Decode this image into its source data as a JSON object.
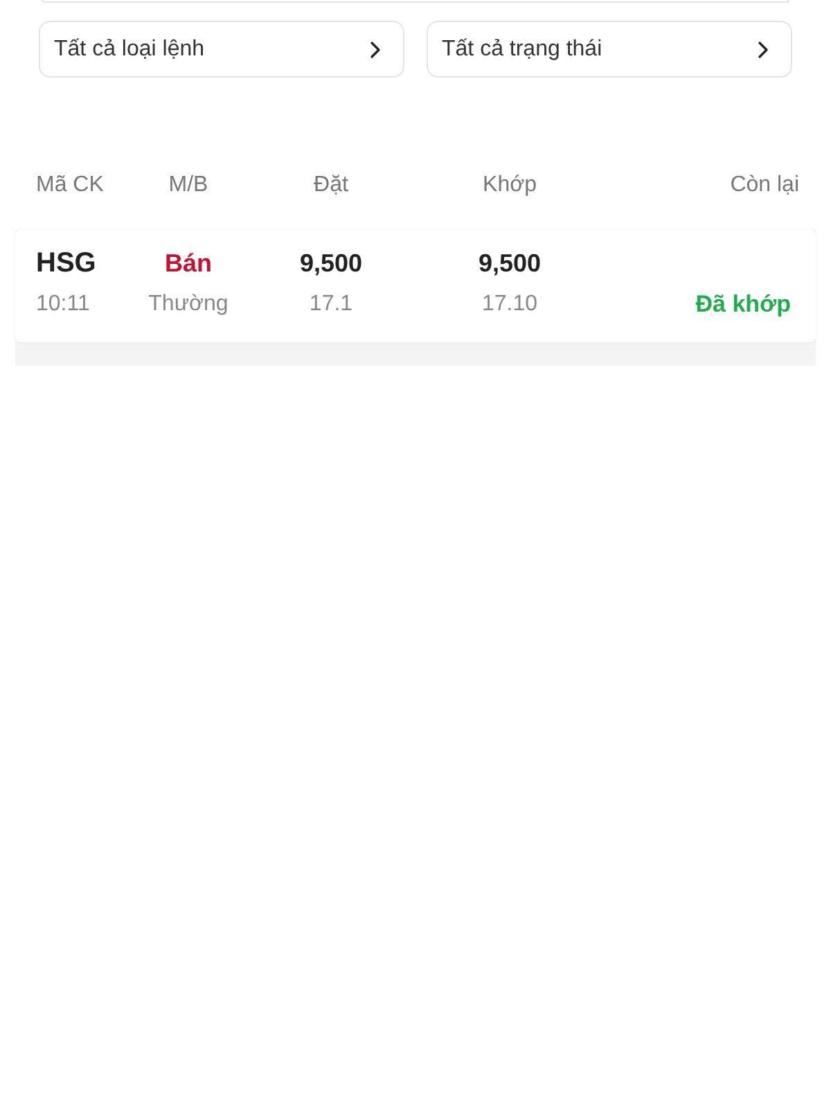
{
  "filters": [
    {
      "label": "Tất cả loại lệnh"
    },
    {
      "label": "Tất cả trạng thái"
    }
  ],
  "table": {
    "columns": [
      "Mã CK",
      "M/B",
      "Đặt",
      "Khớp",
      "Còn lại"
    ],
    "rows": [
      {
        "symbol": "HSG",
        "time": "10:11",
        "side": {
          "text": "Bán",
          "kind": "sell"
        },
        "order_type": "Thường",
        "order_price": "9,500",
        "order_volume": "17.1",
        "matched_price": "9,500",
        "matched_volume": "17.10",
        "status": {
          "text": "Đã khớp",
          "kind": "matched"
        }
      }
    ]
  }
}
